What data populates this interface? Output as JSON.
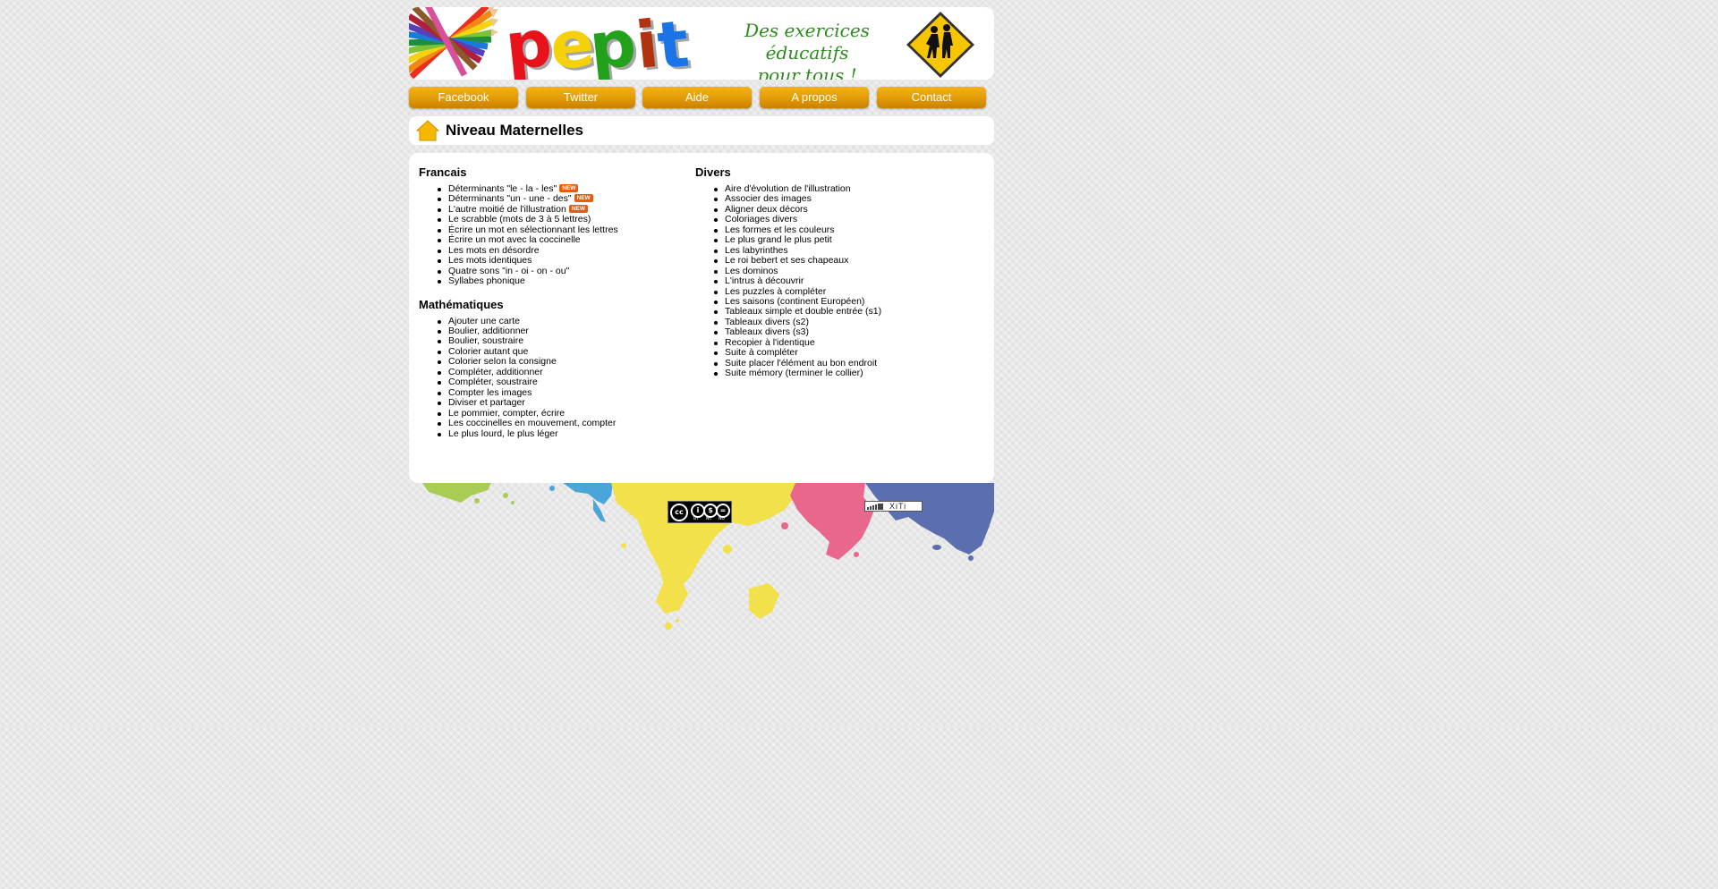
{
  "header": {
    "logo_letters": [
      {
        "char": "p",
        "color": "#e8121b"
      },
      {
        "char": "e",
        "color": "#f5d10a"
      },
      {
        "char": "p",
        "color": "#22a11a"
      },
      {
        "char": "i",
        "color": "#b0320e"
      },
      {
        "char": "t",
        "color": "#1a74e8"
      }
    ],
    "tagline_line1": "Des exercices éducatifs",
    "tagline_line2": "pour tous !"
  },
  "nav": {
    "items": [
      {
        "label": "Facebook"
      },
      {
        "label": "Twitter"
      },
      {
        "label": "Aide"
      },
      {
        "label": "A propos"
      },
      {
        "label": "Contact"
      }
    ]
  },
  "page": {
    "title": "Niveau Maternelles"
  },
  "badges": {
    "new": "NEW"
  },
  "categories": {
    "francais": {
      "title": "Francais",
      "items": [
        {
          "label": "Déterminants \"le - la - les\"",
          "is_new": true
        },
        {
          "label": "Déterminants \"un - une - des\"",
          "is_new": true
        },
        {
          "label": "L'autre moitié de l'illustration",
          "is_new": true
        },
        {
          "label": "Le scrabble (mots de 3 à 5 lettres)"
        },
        {
          "label": "Écrire un mot en sélectionnant les lettres"
        },
        {
          "label": "Écrire un mot avec la coccinelle"
        },
        {
          "label": "Les mots en désordre"
        },
        {
          "label": "Les mots identiques"
        },
        {
          "label": "Quatre sons \"in - oi - on - ou\""
        },
        {
          "label": "Syllabes phonique"
        }
      ]
    },
    "maths": {
      "title": "Mathématiques",
      "items": [
        {
          "label": "Ajouter une carte"
        },
        {
          "label": "Boulier, additionner"
        },
        {
          "label": "Boulier, soustraire"
        },
        {
          "label": "Colorier autant que"
        },
        {
          "label": "Colorier selon la consigne"
        },
        {
          "label": "Compléter, additionner"
        },
        {
          "label": "Compléter, soustraire"
        },
        {
          "label": "Compter les images"
        },
        {
          "label": "Diviser et partager"
        },
        {
          "label": "Le pommier, compter, écrire"
        },
        {
          "label": "Les coccinelles en mouvement, compter"
        },
        {
          "label": "Le plus lourd, le plus léger"
        }
      ]
    },
    "divers": {
      "title": "Divers",
      "items": [
        {
          "label": "Aire d'évolution de l'illustration"
        },
        {
          "label": "Associer des images"
        },
        {
          "label": "Aligner deux décors"
        },
        {
          "label": "Coloriages divers"
        },
        {
          "label": "Les formes et les couleurs"
        },
        {
          "label": "Le plus grand le plus petit"
        },
        {
          "label": "Les labyrinthes"
        },
        {
          "label": "Le roi bebert et ses chapeaux"
        },
        {
          "label": "Les dominos"
        },
        {
          "label": "L'intrus à découvrir"
        },
        {
          "label": "Les puzzles à compléter"
        },
        {
          "label": "Les saisons (continent Européen)"
        },
        {
          "label": "Tableaux simple et double entrée (s1)"
        },
        {
          "label": "Tableaux divers (s2)"
        },
        {
          "label": "Tableaux divers (s3)"
        },
        {
          "label": "Recopier à l'identique"
        },
        {
          "label": "Suite à compléter"
        },
        {
          "label": "Suite placer l'élément au bon endroit"
        },
        {
          "label": "Suite mémory (terminer le collier)"
        }
      ]
    }
  },
  "footer": {
    "cc_sub_by": "BY",
    "cc_sub_nc": "NC",
    "cc_sub_nd": "ND",
    "xiti_label": "XiTi"
  },
  "colors": {
    "nav_orange": "#e29b06",
    "new_badge": "#e85c0d",
    "tagline_green": "#2e8b1e",
    "home_icon": "#f5b800"
  }
}
